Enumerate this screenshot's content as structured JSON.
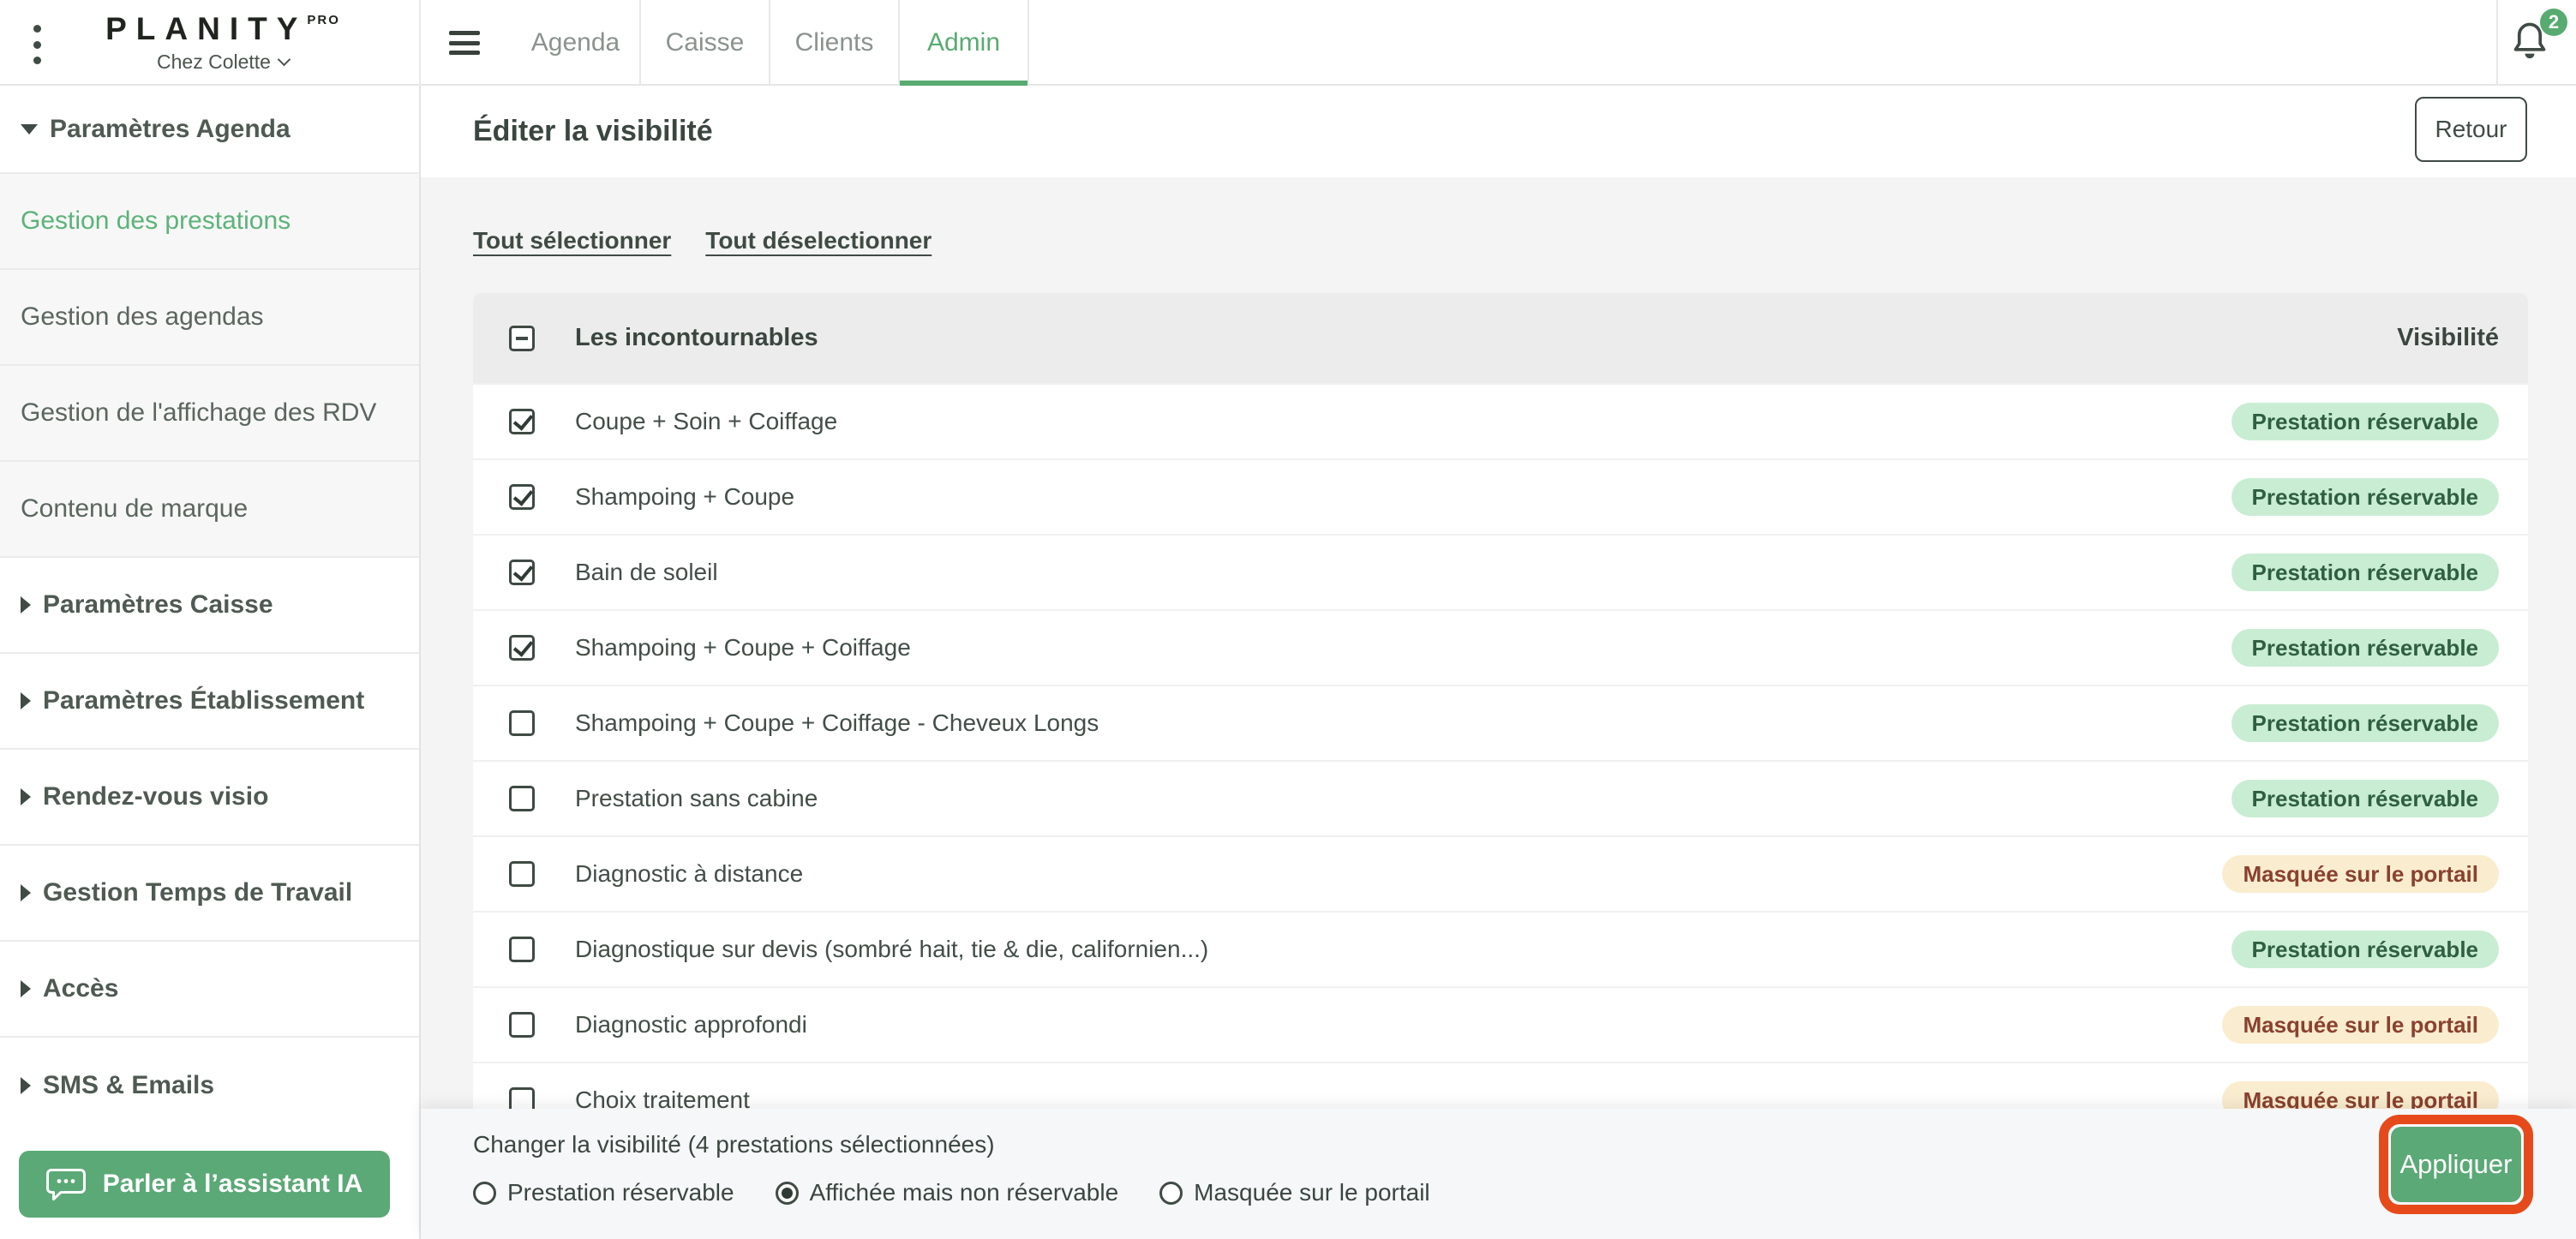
{
  "topbar": {
    "logo": "PLANITY",
    "logo_badge": "PRO",
    "establishment": "Chez Colette",
    "tabs": [
      {
        "label": "Agenda",
        "active": false
      },
      {
        "label": "Caisse",
        "active": false
      },
      {
        "label": "Clients",
        "active": false
      },
      {
        "label": "Admin",
        "active": true
      }
    ],
    "notification_count": "2"
  },
  "sidebar": {
    "sections": [
      {
        "label": "Paramètres Agenda",
        "expanded": true
      },
      {
        "label": "Paramètres Caisse",
        "expanded": false
      },
      {
        "label": "Paramètres Établissement",
        "expanded": false
      },
      {
        "label": "Rendez-vous visio",
        "expanded": false
      },
      {
        "label": "Gestion Temps de Travail",
        "expanded": false
      },
      {
        "label": "Accès",
        "expanded": false
      },
      {
        "label": "SMS & Emails",
        "expanded": false
      }
    ],
    "agenda_items": [
      {
        "label": "Gestion des prestations",
        "active": true
      },
      {
        "label": "Gestion des agendas",
        "active": false
      },
      {
        "label": "Gestion de l'affichage des RDV",
        "active": false
      },
      {
        "label": "Contenu de marque",
        "active": false
      }
    ],
    "assistant_button": "Parler à l’assistant IA"
  },
  "main": {
    "title": "Éditer la visibilité",
    "back_button": "Retour",
    "select_all": "Tout sélectionner",
    "deselect_all": "Tout déselectionner",
    "table": {
      "group_header": "Les incontournables",
      "visibility_header": "Visibilité",
      "rows": [
        {
          "label": "Coupe + Soin + Coiffage",
          "checked": true,
          "badge": "Prestation réservable",
          "badge_type": "green"
        },
        {
          "label": "Shampoing + Coupe",
          "checked": true,
          "badge": "Prestation réservable",
          "badge_type": "green"
        },
        {
          "label": "Bain de soleil",
          "checked": true,
          "badge": "Prestation réservable",
          "badge_type": "green"
        },
        {
          "label": "Shampoing + Coupe + Coiffage",
          "checked": true,
          "badge": "Prestation réservable",
          "badge_type": "green"
        },
        {
          "label": "Shampoing + Coupe + Coiffage - Cheveux Longs",
          "checked": false,
          "badge": "Prestation réservable",
          "badge_type": "green"
        },
        {
          "label": "Prestation sans cabine",
          "checked": false,
          "badge": "Prestation réservable",
          "badge_type": "green"
        },
        {
          "label": "Diagnostic à distance",
          "checked": false,
          "badge": "Masquée sur le portail",
          "badge_type": "orange"
        },
        {
          "label": "Diagnostique sur devis (sombré hait, tie & die, californien...)",
          "checked": false,
          "badge": "Prestation réservable",
          "badge_type": "green"
        },
        {
          "label": "Diagnostic approfondi",
          "checked": false,
          "badge": "Masquée sur le portail",
          "badge_type": "orange"
        },
        {
          "label": "Choix traitement",
          "checked": false,
          "badge": "Masquée sur le portail",
          "badge_type": "orange"
        }
      ]
    },
    "footer": {
      "change_label": "Changer la visibilité (4 prestations sélectionnées)",
      "radios": [
        {
          "label": "Prestation réservable",
          "selected": false
        },
        {
          "label": "Affichée mais non réservable",
          "selected": true
        },
        {
          "label": "Masquée sur le portail",
          "selected": false
        }
      ],
      "apply_button": "Appliquer"
    }
  },
  "colors": {
    "accent_green": "#57AB70",
    "button_green": "#5BA976",
    "badge_green_bg": "#C9EDD3",
    "badge_green_text": "#2F5F41",
    "badge_orange_bg": "#FAEDCF",
    "badge_orange_text": "#8A4130",
    "highlight_red": "#E64A1B"
  }
}
